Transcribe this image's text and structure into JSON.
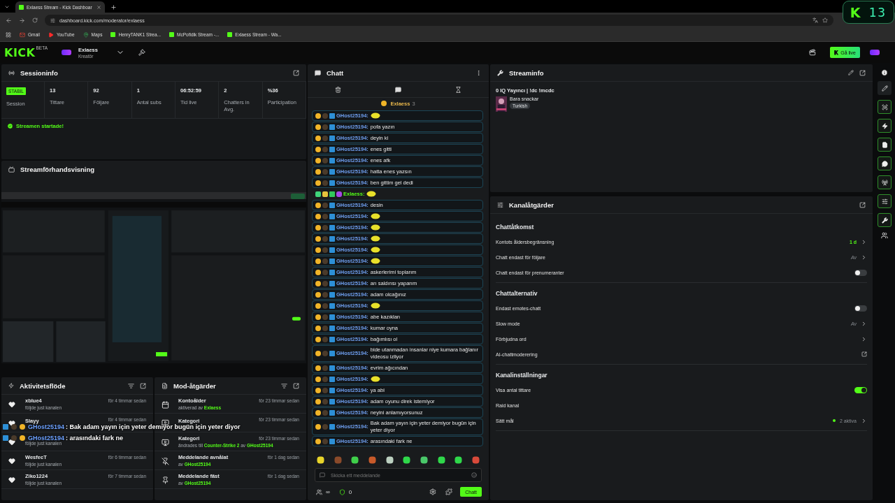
{
  "browser": {
    "tab_title": "Exlaess Stream - Kick Dashboar",
    "url": "dashboard.kick.com/moderator/exlaess",
    "bookmarks": [
      {
        "kind": "mail",
        "label": "Gmail"
      },
      {
        "kind": "video",
        "label": "YouTube"
      },
      {
        "kind": "map",
        "label": "Maps"
      },
      {
        "kind": "kick",
        "label": "HenryTANK1 Strea..."
      },
      {
        "kind": "kick",
        "label": "McPofidik Stream -..."
      },
      {
        "kind": "kick",
        "label": "Exlaess Stream - Wa..."
      }
    ]
  },
  "widget": {
    "logo": "K",
    "count": "13"
  },
  "header": {
    "logo": "KICK",
    "logo_badge": "BETA",
    "channel": "Exlaess",
    "role": "Kreatör",
    "go_live": "Gå live"
  },
  "session": {
    "title": "Sessioninfo",
    "badge": "STABIL",
    "label": "Session",
    "stats": [
      {
        "value": "13",
        "label": "Tittare"
      },
      {
        "value": "92",
        "label": "Följare"
      },
      {
        "value": "1",
        "label": "Antal subs"
      },
      {
        "value": "06:52:59",
        "label": "Tid live"
      },
      {
        "value": "2",
        "label": "Chatters in Avg."
      },
      {
        "value": "%36",
        "label": "Participation"
      }
    ],
    "status": "Streamen startade!"
  },
  "preview": {
    "title": "Streamförhandsvisning",
    "kind": "picture"
  },
  "activity": {
    "title": "Aktivitetsflöde",
    "items": [
      {
        "name": "xblue4",
        "time": "för 4 timmar sedan",
        "text": "följde just kanalen"
      },
      {
        "name": "Slayy",
        "time": "för 4 timmar sedan"
      },
      {
        "text": "följde just kanalen"
      },
      {
        "name": "WesfecT",
        "time": "för 6 timmar sedan",
        "text": "följde just kanalen"
      },
      {
        "name": "Ziko1224",
        "time": "för 7 timmar sedan",
        "text": "följde just kanalen"
      }
    ]
  },
  "mod_actions": {
    "title": "Mod-åtgärder",
    "items": [
      {
        "kind": "calendar",
        "title": "Kontoålder",
        "time": "för 23 timmar sedan",
        "text": "aktiverad av **Exlaess**"
      },
      {
        "kind": "category",
        "title": "Kategori",
        "time": "för 23 timmar sedan"
      },
      {
        "kind": "category",
        "title": "Kategori",
        "time": "för 23 timmar sedan",
        "text": "ändrades till **Counter-Strike 2** av **GHost25194**"
      },
      {
        "kind": "unpin",
        "title": "Meddelande avnålat",
        "time": "för 1 dag sedan",
        "text": "av **GHost25194**"
      },
      {
        "kind": "pin",
        "title": "Meddelande fäst",
        "time": "för 1 dag sedan",
        "text": "av **GHost25194**"
      }
    ]
  },
  "overlay_chat": [
    {
      "user": "GHost25194",
      "text": " : Bak adam yayın için yeter demiyor bugün için yeter diyor"
    },
    {
      "user": "GHost25194",
      "text": " : arasındaki fark ne"
    }
  ],
  "chat": {
    "title": "Chatt",
    "pinned_user": "Exlaess",
    "pinned_count": "3",
    "messages": [
      {
        "kind": "mod",
        "user": "GHost25194:",
        "emote": true
      },
      {
        "kind": "mod",
        "user": "GHost25194:",
        "text": "pofa yazın",
        "emote": false
      },
      {
        "kind": "mod",
        "user": "GHost25194:",
        "text": "deyin ki",
        "emote": false
      },
      {
        "kind": "mod",
        "user": "GHost25194:",
        "text": "enes gitti",
        "emote": false
      },
      {
        "kind": "mod",
        "user": "GHost25194:",
        "text": "enes afk",
        "emote": false
      },
      {
        "kind": "mod",
        "user": "GHost25194:",
        "text": "hatta enes yazsın",
        "emote": false
      },
      {
        "kind": "mod",
        "user": "GHost25194:",
        "text": "ben gittim gel dedi",
        "emote": false
      },
      {
        "kind": "owner",
        "user": "Exlaess:",
        "emote": true
      },
      {
        "kind": "mod",
        "user": "GHost25194:",
        "text": "desin",
        "emote": false
      },
      {
        "kind": "mod",
        "user": "GHost25194:",
        "emote": true
      },
      {
        "kind": "mod",
        "user": "GHost25194:",
        "emote": true
      },
      {
        "kind": "mod",
        "user": "GHost25194:",
        "emote": true
      },
      {
        "kind": "mod",
        "user": "GHost25194:",
        "emote": true
      },
      {
        "kind": "mod",
        "user": "GHost25194:",
        "emote": true
      },
      {
        "kind": "mod",
        "user": "GHost25194:",
        "text": "askerlerimi toplarım",
        "emote": false
      },
      {
        "kind": "mod",
        "user": "GHost25194:",
        "text": "arı saldırısı yaparım",
        "emote": false
      },
      {
        "kind": "mod",
        "user": "GHost25194:",
        "text": "adam olcağınız",
        "emote": false
      },
      {
        "kind": "mod",
        "user": "GHost25194:",
        "emote": true
      },
      {
        "kind": "mod",
        "user": "GHost25194:",
        "text": "abe kazıklan",
        "emote": false
      },
      {
        "kind": "mod",
        "user": "GHost25194:",
        "text": "kumar oyna",
        "emote": false
      },
      {
        "kind": "mod",
        "user": "GHost25194:",
        "text": "bağımlısı ol",
        "emote": false
      },
      {
        "kind": "mod",
        "user": "GHost25194:",
        "text": "bide utanmadan insanlar niye kumara bağlanır videosu izliyor",
        "emote": false
      },
      {
        "kind": "mod",
        "user": "GHost25194:",
        "text": "evrim ağıcından",
        "emote": false
      },
      {
        "kind": "mod",
        "user": "GHost25194:",
        "emote": true
      },
      {
        "kind": "mod",
        "user": "GHost25194:",
        "text": "ya abi",
        "emote": false
      },
      {
        "kind": "mod",
        "user": "GHost25194:",
        "text": "adam oyunu direk istemiyor",
        "emote": false
      },
      {
        "kind": "mod",
        "user": "GHost25194:",
        "text": "neyini anlamıyorsunuz",
        "emote": false
      },
      {
        "kind": "mod",
        "user": "GHost25194:",
        "text": "Bak adam yayın için yeter demiyor bugün için yeter diyor",
        "emote": false
      },
      {
        "kind": "mod",
        "user": "GHost25194:",
        "text": "arasındaki fark ne",
        "emote": false
      }
    ],
    "input": {
      "placeholder": "Skicka ett meddelande"
    },
    "viewers": "∞",
    "points": "0",
    "send": "Chatt"
  },
  "stream_info": {
    "title": "Streaminfo",
    "stream_title": "0 IQ Yayıncı | !dc !mcdc",
    "category": "Bara snackar",
    "tag": "Turkish"
  },
  "channel_actions": {
    "title": "Kanalåtgärder",
    "sections": [
      {
        "title": "Chattåtkomst",
        "items": [
          {
            "label": "Kontots åldersbegränsning",
            "kind": "nav",
            "value": "1 d",
            "accent": true,
            "status_dot": false
          },
          {
            "label": "Chatt endast för följare",
            "kind": "nav",
            "value": "Av",
            "accent": false,
            "status_dot": false
          },
          {
            "label": "Chatt endast för prenumeranter",
            "kind": "toggle",
            "on": false
          }
        ]
      },
      {
        "title": "Chattalternativ",
        "items": [
          {
            "label": "Endast emotes-chatt",
            "kind": "toggle",
            "on": false
          },
          {
            "label": "Slow mode",
            "kind": "nav",
            "value": "Av",
            "accent": false,
            "status_dot": false
          },
          {
            "label": "Förbjudna ord",
            "kind": "nav"
          },
          {
            "label": "AI-chattmoderering",
            "kind": "external"
          }
        ]
      },
      {
        "title": "Kanalinställningar",
        "items": [
          {
            "label": "Visa antal tittare",
            "kind": "toggle",
            "on": true
          },
          {
            "label": "Raid kanal",
            "kind": "plain"
          },
          {
            "label": "Sätt mål",
            "kind": "nav",
            "value": "2 aktiva",
            "accent": false,
            "status_dot": true
          }
        ]
      }
    ]
  }
}
